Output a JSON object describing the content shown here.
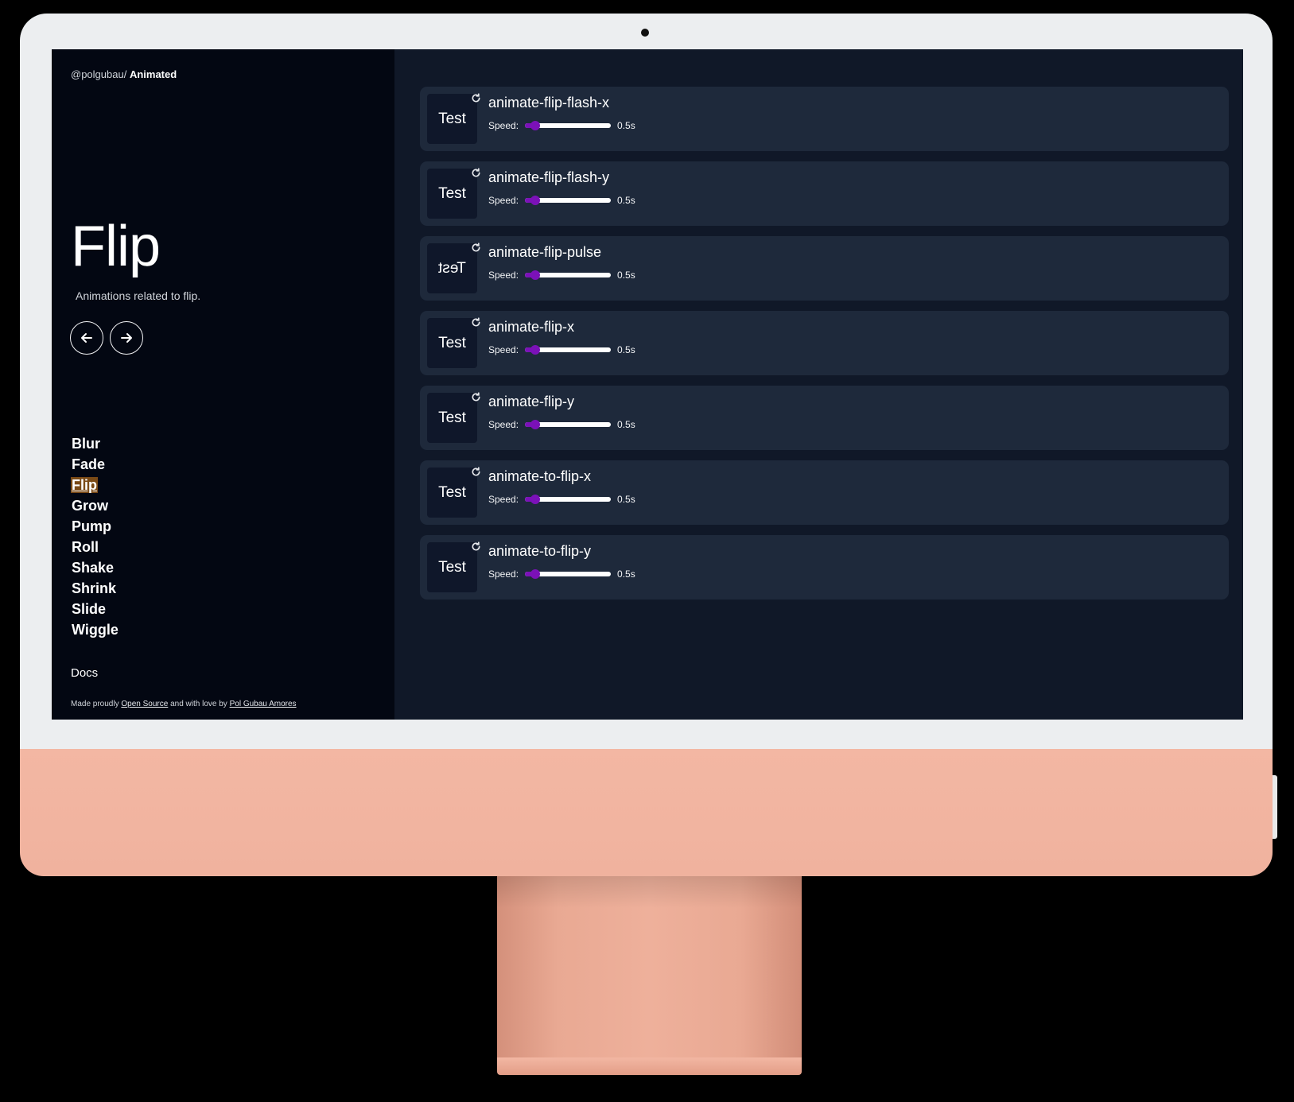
{
  "breadcrumb": {
    "site": "@polgubau/",
    "app": "Animated"
  },
  "page": {
    "title": "Flip",
    "description": "Animations related to flip."
  },
  "nav_arrows": {
    "prev_icon": "arrow-left-icon",
    "next_icon": "arrow-right-icon"
  },
  "categories": [
    {
      "label": "Blur",
      "active": false
    },
    {
      "label": "Fade",
      "active": false
    },
    {
      "label": "Flip",
      "active": true
    },
    {
      "label": "Grow",
      "active": false
    },
    {
      "label": "Pump",
      "active": false
    },
    {
      "label": "Roll",
      "active": false
    },
    {
      "label": "Shake",
      "active": false
    },
    {
      "label": "Shrink",
      "active": false
    },
    {
      "label": "Slide",
      "active": false
    },
    {
      "label": "Wiggle",
      "active": false
    }
  ],
  "docs_label": "Docs",
  "footer": {
    "prefix": "Made proudly",
    "link1": "Open Source",
    "middle": "and with love by",
    "link2": "Pol Gubau Amores"
  },
  "animations": [
    {
      "name": "animate-flip-flash-x",
      "test_label": "Test",
      "speed_label": "Speed:",
      "speed": "0.5s",
      "speed_fraction": 0.12,
      "mirrored": false
    },
    {
      "name": "animate-flip-flash-y",
      "test_label": "Test",
      "speed_label": "Speed:",
      "speed": "0.5s",
      "speed_fraction": 0.12,
      "mirrored": false
    },
    {
      "name": "animate-flip-pulse",
      "test_label": "Test",
      "speed_label": "Speed:",
      "speed": "0.5s",
      "speed_fraction": 0.12,
      "mirrored": true
    },
    {
      "name": "animate-flip-x",
      "test_label": "Test",
      "speed_label": "Speed:",
      "speed": "0.5s",
      "speed_fraction": 0.12,
      "mirrored": false
    },
    {
      "name": "animate-flip-y",
      "test_label": "Test",
      "speed_label": "Speed:",
      "speed": "0.5s",
      "speed_fraction": 0.12,
      "mirrored": false
    },
    {
      "name": "animate-to-flip-x",
      "test_label": "Test",
      "speed_label": "Speed:",
      "speed": "0.5s",
      "speed_fraction": 0.12,
      "mirrored": false
    },
    {
      "name": "animate-to-flip-y",
      "test_label": "Test",
      "speed_label": "Speed:",
      "speed": "0.5s",
      "speed_fraction": 0.12,
      "mirrored": false
    }
  ],
  "colors": {
    "sidebar_bg": "#030712",
    "main_bg": "#101828",
    "card_bg": "#1e293b",
    "slider_accent": "#7b11b8",
    "active_highlight": "#7a4a16",
    "monitor_body": "#f0b29e"
  }
}
